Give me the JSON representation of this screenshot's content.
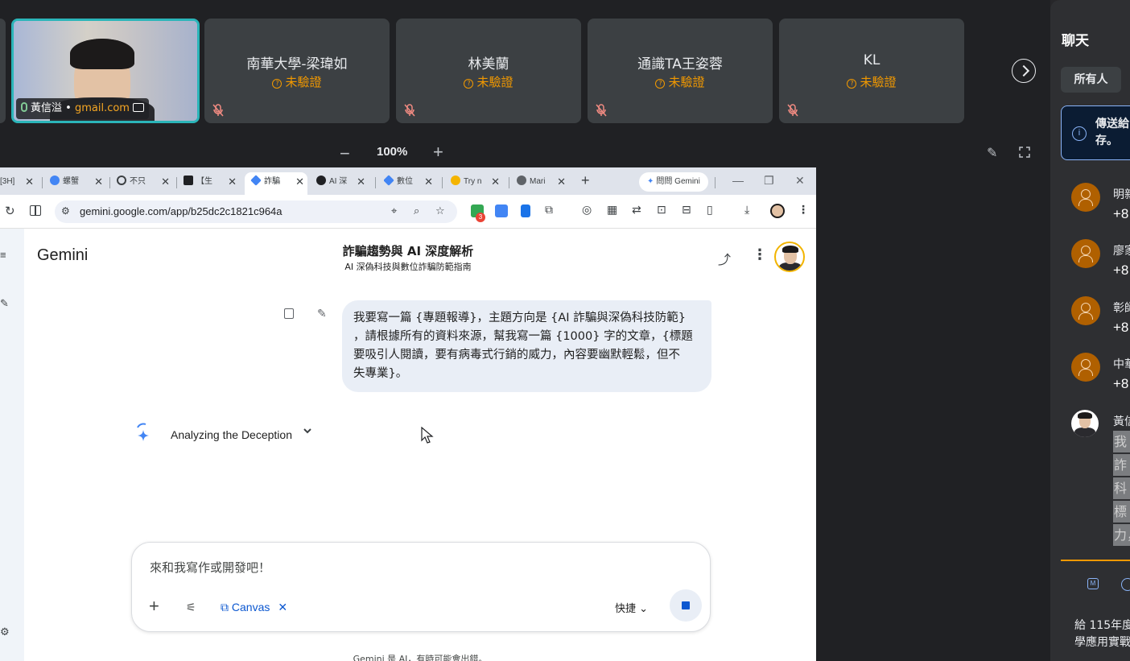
{
  "meet": {
    "self_tile": {
      "name": "黃信溢",
      "separator": "•",
      "email": "gmail.com"
    },
    "participants": [
      {
        "name": "南華大學-梁瑋如",
        "status": "未驗證"
      },
      {
        "name": "林美蘭",
        "status": "未驗證"
      },
      {
        "name": "通識TA王姿蓉",
        "status": "未驗證"
      },
      {
        "name": "KL",
        "status": "未驗證"
      }
    ],
    "zoom": {
      "minus": "−",
      "level": "100%",
      "plus": "+"
    }
  },
  "browser": {
    "tabs": [
      {
        "label": "[3H]",
        "favicon_color": "#ffffff"
      },
      {
        "label": "螺蟹",
        "favicon_color": "#4285f4"
      },
      {
        "label": "不只",
        "favicon_color": "#3c4043"
      },
      {
        "label": "【生",
        "favicon_color": "#202124"
      },
      {
        "label": "詐騙",
        "favicon_color": "#4285f4",
        "active": true
      },
      {
        "label": "AI 深",
        "favicon_color": "#202124"
      },
      {
        "label": "數位",
        "favicon_color": "#4285f4"
      },
      {
        "label": "Try n",
        "favicon_color": "#f4b400"
      },
      {
        "label": "Mari",
        "favicon_color": "#5f6368"
      }
    ],
    "new_tab": "+",
    "ask_gemini": "問問 Gemini",
    "window_controls": {
      "minimize": "—",
      "restore": "❐",
      "close": "✕"
    },
    "url": "gemini.google.com/app/b25dc2c1821c964a",
    "extension_badge": "3"
  },
  "gemini": {
    "brand": "Gemini",
    "conversation_title": "詐騙趨勢與 AI 深度解析",
    "conversation_subtitle": "AI 深偽科技與數位詐騙防範指南",
    "user_message_lines": [
      "我要寫一篇 {專題報導}，主題方向是 {AI 詐騙與深偽科技防範}",
      "，請根據所有的資料來源，幫我寫一篇 {1000} 字的文章，{標題",
      "要吸引人閱讀，要有病毒式行銷的威力，內容要幽默輕鬆，但不",
      "失專業}。"
    ],
    "thinking_label": "Analyzing the Deception",
    "composer": {
      "placeholder": "來和我寫作或開發吧！",
      "canvas_chip": "Canvas",
      "model_label": "快捷"
    },
    "disclaimer": "Gemini 是 AI，有時可能會出錯。"
  },
  "chat_panel": {
    "title": "聊天",
    "recipient": "所有人",
    "notice": "傳送給\n存。",
    "messages": [
      {
        "name": "明新",
        "text": "+8"
      },
      {
        "name": "廖家",
        "text": "+8"
      },
      {
        "name": "彰師",
        "text": "+8"
      },
      {
        "name": "中華",
        "text": "+8"
      }
    ],
    "self_message": {
      "name": "黃信",
      "lines": [
        "我要",
        "詐騙",
        "科技",
        "標題",
        "力，"
      ]
    },
    "draft_text": "給 115年度\n學應用實戰"
  },
  "colors": {
    "meet_bg": "#202124",
    "tile_bg": "#3c4043",
    "unverified": "#f29900",
    "self_tile_border": "#2bb5b9",
    "gemini_blue": "#0b57d0",
    "bubble_bg": "#e9eef6"
  }
}
